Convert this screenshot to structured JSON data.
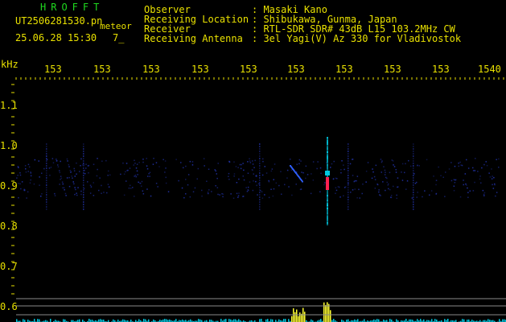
{
  "header": {
    "app_name": "HROFFT",
    "filename": "UT2506281530.pn",
    "meteor_label": "meteor",
    "datetime": "25.06.28 15:30",
    "count": "7_",
    "fields": [
      {
        "label": "Observer",
        "value": ": Masaki Kano"
      },
      {
        "label": "Receiving Location",
        "value": ": Shibukawa, Gunma, Japan"
      },
      {
        "label": "Receiver",
        "value": ": RTL-SDR SDR# 43dB L15 103.2MHz CW"
      },
      {
        "label": "Receiving Antenna",
        "value": ": 3el Yagi(V) Az 330 for Vladivostok"
      }
    ]
  },
  "axis": {
    "unit": "kHz",
    "x_ticks": [
      "153",
      "153",
      "153",
      "153",
      "153",
      "153",
      "153",
      "153",
      "153",
      "1540"
    ],
    "y_ticks": [
      "1.1",
      "1.0",
      "0.9",
      "0.8",
      "0.7",
      "0.6"
    ]
  },
  "colors": {
    "header_green": "#1fd81f",
    "text_yellow": "#e8e000",
    "trace_cyan": "#00c8e0",
    "trace_yellow": "#ffff30",
    "noise_blue": "#2030a0",
    "guide_gray": "#8a8a8a"
  }
}
